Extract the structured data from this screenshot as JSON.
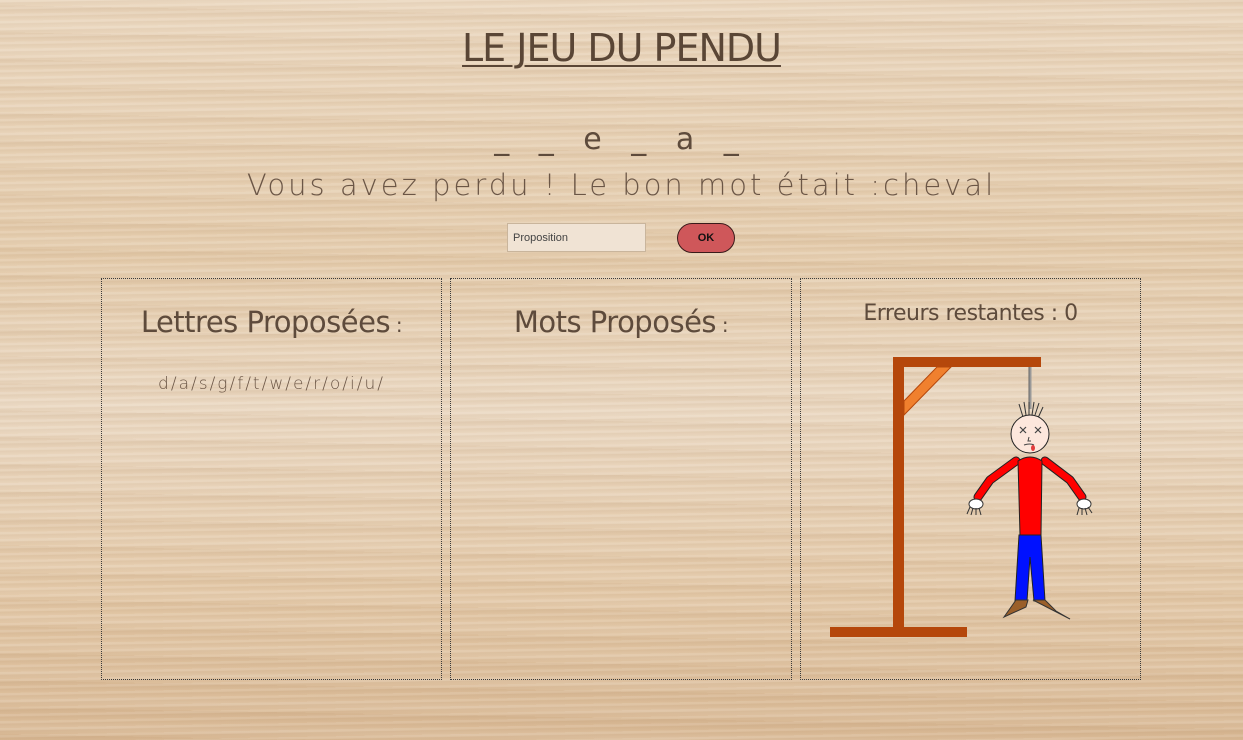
{
  "header": {
    "title": "LE JEU DU PENDU"
  },
  "game": {
    "word_mask": "_ _ e _ a _",
    "result_message": "Vous avez perdu ! Le bon mot était :cheval"
  },
  "form": {
    "input_placeholder": "Proposition",
    "input_value": "",
    "ok_label": "OK"
  },
  "panels": {
    "letters": {
      "title": "Lettres Proposées",
      "colon": " :",
      "content": "d/a/s/g/f/t/w/e/r/o/i/u/"
    },
    "words": {
      "title": "Mots Proposés",
      "colon": " :",
      "content": ""
    },
    "errors": {
      "label": "Erreurs restantes : ",
      "count": "0"
    }
  },
  "colors": {
    "gallows": "#b5470b",
    "brace": "#f0802e",
    "shirt": "#ff0000",
    "pants": "#0011ff",
    "shoes": "#9a5f2a",
    "ok_button": "#cf575a"
  }
}
